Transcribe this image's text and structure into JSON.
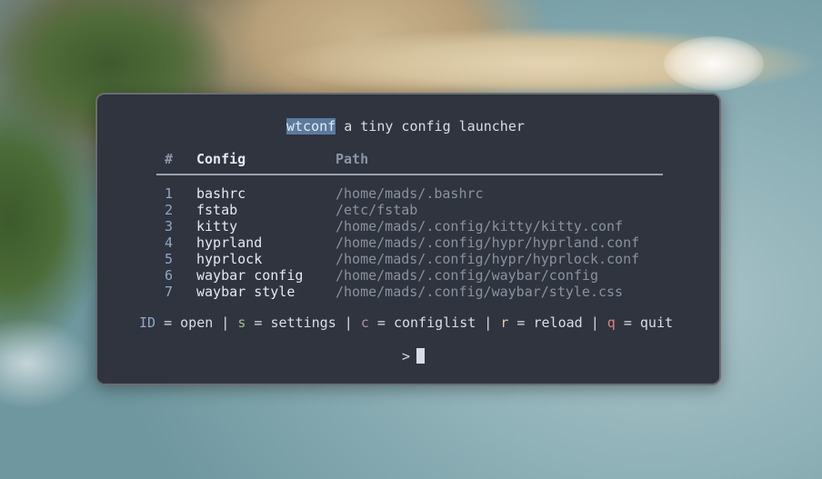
{
  "app": {
    "title_highlight": "wtconf",
    "title_rest": " a tiny config launcher"
  },
  "table": {
    "headers": {
      "num": "#",
      "config": "Config",
      "path": "Path"
    },
    "rows": [
      {
        "id": "1",
        "name": "bashrc",
        "path": "/home/mads/.bashrc"
      },
      {
        "id": "2",
        "name": "fstab",
        "path": "/etc/fstab"
      },
      {
        "id": "3",
        "name": "kitty",
        "path": "/home/mads/.config/kitty/kitty.conf"
      },
      {
        "id": "4",
        "name": "hyprland",
        "path": "/home/mads/.config/hypr/hyprland.conf"
      },
      {
        "id": "5",
        "name": "hyprlock",
        "path": "/home/mads/.config/hypr/hyprlock.conf"
      },
      {
        "id": "6",
        "name": "waybar config",
        "path": "/home/mads/.config/waybar/config"
      },
      {
        "id": "7",
        "name": "waybar style",
        "path": "/home/mads/.config/waybar/style.css"
      }
    ]
  },
  "help": {
    "id_key": "ID",
    "id_text": " = open | ",
    "s_key": "s",
    "s_text": " = settings | ",
    "c_key": "c",
    "c_text": " = configlist | ",
    "r_key": "r",
    "r_text": " = reload | ",
    "q_key": "q",
    "q_text": " = quit"
  },
  "prompt": {
    "symbol": ">"
  },
  "colors": {
    "terminal_bg": "#2f343f",
    "highlight": "#5b7a9c",
    "key_id": "#8fa8c6",
    "key_s": "#a3be8c",
    "key_c": "#b48ead",
    "key_r": "#ebcb8b",
    "key_q": "#e0807a"
  }
}
